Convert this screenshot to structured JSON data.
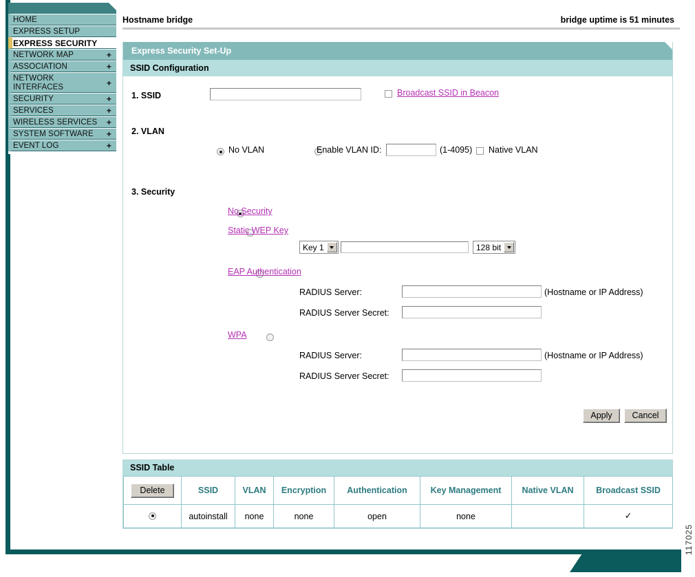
{
  "sidebar": {
    "items": [
      {
        "label": "HOME",
        "expandable": false,
        "selected": false
      },
      {
        "label": "EXPRESS SETUP",
        "expandable": false,
        "selected": false
      },
      {
        "label": "EXPRESS SECURITY",
        "expandable": false,
        "selected": true
      },
      {
        "label": "NETWORK MAP",
        "expandable": true,
        "selected": false
      },
      {
        "label": "ASSOCIATION",
        "expandable": true,
        "selected": false
      },
      {
        "label": "NETWORK\nINTERFACES",
        "expandable": true,
        "selected": false
      },
      {
        "label": "SECURITY",
        "expandable": true,
        "selected": false
      },
      {
        "label": "SERVICES",
        "expandable": true,
        "selected": false
      },
      {
        "label": "WIRELESS SERVICES",
        "expandable": true,
        "selected": false
      },
      {
        "label": "SYSTEM SOFTWARE",
        "expandable": true,
        "selected": false
      },
      {
        "label": "EVENT LOG",
        "expandable": true,
        "selected": false
      }
    ],
    "expand_glyph": "+"
  },
  "header": {
    "hostname_label": "Hostname  bridge",
    "uptime_label": "bridge uptime is 51 minutes"
  },
  "panel": {
    "title": "Express Security Set-Up",
    "subtitle": "SSID Configuration"
  },
  "ssid_section": {
    "step_label": "1. SSID",
    "ssid_value": "",
    "broadcast_checkbox_checked": false,
    "broadcast_link": "Broadcast SSID in Beacon"
  },
  "vlan_section": {
    "step_label": "2. VLAN",
    "no_vlan_label": "No VLAN",
    "no_vlan_selected": true,
    "enable_vlan_label": "Enable VLAN ID:",
    "enable_vlan_selected": false,
    "vlan_id_value": "",
    "vlan_range_hint": "(1-4095)",
    "native_vlan_label": "Native VLAN",
    "native_vlan_checked": false
  },
  "security_section": {
    "step_label": "3. Security",
    "options": [
      {
        "label": "No Security",
        "selected": true
      },
      {
        "label": "Static WEP Key",
        "selected": false
      },
      {
        "label": "EAP Authentication",
        "selected": false
      },
      {
        "label": "WPA",
        "selected": false
      }
    ],
    "wep": {
      "key_select_value": "Key 1",
      "key_value": "",
      "bits_select_value": "128 bit"
    },
    "eap": {
      "radius_server_label": "RADIUS Server:",
      "radius_server_value": "",
      "hostname_hint": "(Hostname or IP Address)",
      "radius_secret_label": "RADIUS Server Secret:",
      "radius_secret_value": ""
    },
    "wpa": {
      "radius_server_label": "RADIUS Server:",
      "radius_server_value": "",
      "hostname_hint": "(Hostname or IP Address)",
      "radius_secret_label": "RADIUS Server Secret:",
      "radius_secret_value": ""
    }
  },
  "actions": {
    "apply_label": "Apply",
    "cancel_label": "Cancel"
  },
  "ssid_table": {
    "title": "SSID Table",
    "delete_label": "Delete",
    "columns": [
      "SSID",
      "VLAN",
      "Encryption",
      "Authentication",
      "Key Management",
      "Native VLAN",
      "Broadcast SSID"
    ],
    "rows": [
      {
        "selected": true,
        "ssid": "autoinstall",
        "vlan": "none",
        "encryption": "none",
        "authentication": "open",
        "key_management": "none",
        "native_vlan": "",
        "broadcast_ssid": "✓"
      }
    ]
  },
  "footer": {
    "doc_number": "117025"
  },
  "colors": {
    "dark_teal": "#0b5a5c",
    "panel_header_teal": "#84b9ba",
    "panel_sub_teal": "#b6dede",
    "sidebar_item_teal": "#8fc0c0",
    "sidebar_top_teal": "#3d8183",
    "link_magenta": "#b42fb4",
    "table_header_text": "#2d7b80",
    "selected_accent": "#e0c060"
  }
}
